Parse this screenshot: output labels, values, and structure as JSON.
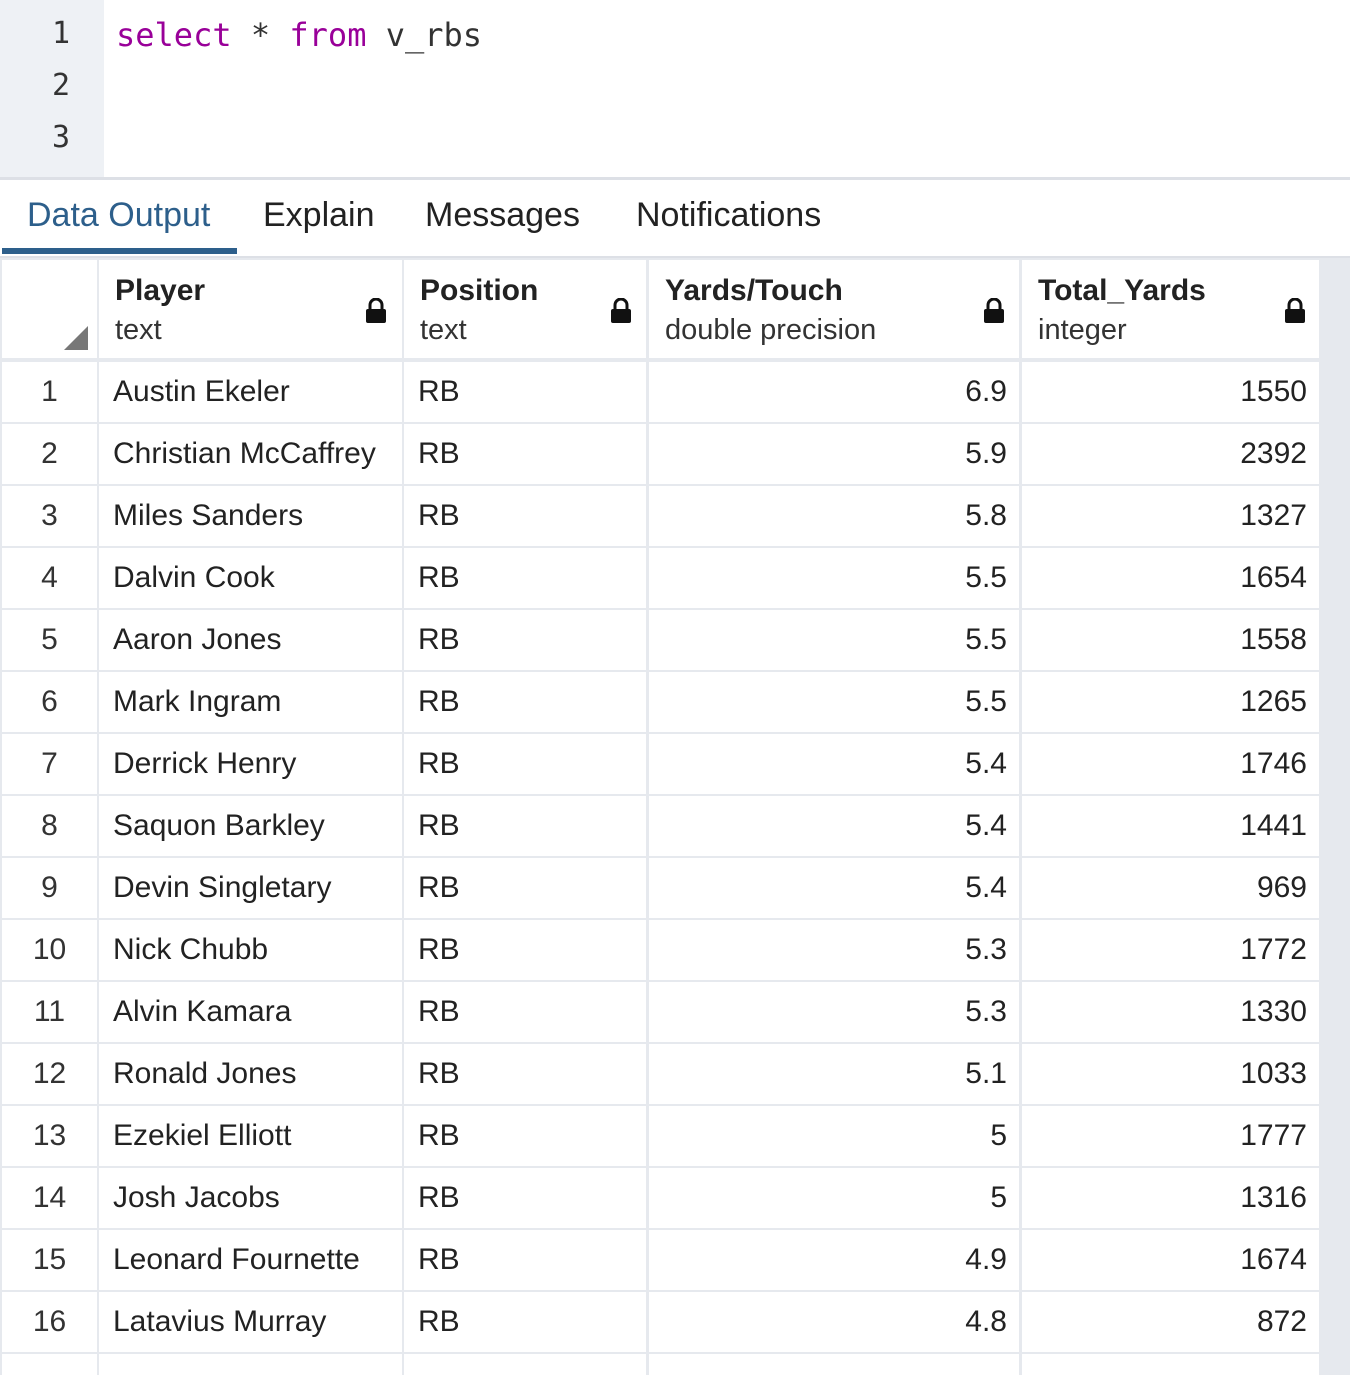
{
  "editor": {
    "line_numbers": [
      "1",
      "2",
      "3"
    ],
    "query": {
      "kw_select": "select",
      "star": "*",
      "kw_from": "from",
      "table": "v_rbs"
    }
  },
  "tabs": [
    {
      "label": "Data Output",
      "active": true
    },
    {
      "label": "Explain",
      "active": false
    },
    {
      "label": "Messages",
      "active": false
    },
    {
      "label": "Notifications",
      "active": false
    }
  ],
  "columns": [
    {
      "name": "Player",
      "type": "text",
      "locked": true
    },
    {
      "name": "Position",
      "type": "text",
      "locked": true
    },
    {
      "name": "Yards/Touch",
      "type": "double precision",
      "locked": true
    },
    {
      "name": "Total_Yards",
      "type": "integer",
      "locked": true
    }
  ],
  "rows": [
    {
      "n": "1",
      "player": "Austin Ekeler",
      "position": "RB",
      "ypt": "6.9",
      "yards": "1550"
    },
    {
      "n": "2",
      "player": "Christian McCaffrey",
      "position": "RB",
      "ypt": "5.9",
      "yards": "2392"
    },
    {
      "n": "3",
      "player": "Miles Sanders",
      "position": "RB",
      "ypt": "5.8",
      "yards": "1327"
    },
    {
      "n": "4",
      "player": "Dalvin Cook",
      "position": "RB",
      "ypt": "5.5",
      "yards": "1654"
    },
    {
      "n": "5",
      "player": "Aaron Jones",
      "position": "RB",
      "ypt": "5.5",
      "yards": "1558"
    },
    {
      "n": "6",
      "player": "Mark Ingram",
      "position": "RB",
      "ypt": "5.5",
      "yards": "1265"
    },
    {
      "n": "7",
      "player": "Derrick Henry",
      "position": "RB",
      "ypt": "5.4",
      "yards": "1746"
    },
    {
      "n": "8",
      "player": "Saquon Barkley",
      "position": "RB",
      "ypt": "5.4",
      "yards": "1441"
    },
    {
      "n": "9",
      "player": "Devin Singletary",
      "position": "RB",
      "ypt": "5.4",
      "yards": "969"
    },
    {
      "n": "10",
      "player": "Nick Chubb",
      "position": "RB",
      "ypt": "5.3",
      "yards": "1772"
    },
    {
      "n": "11",
      "player": "Alvin Kamara",
      "position": "RB",
      "ypt": "5.3",
      "yards": "1330"
    },
    {
      "n": "12",
      "player": "Ronald Jones",
      "position": "RB",
      "ypt": "5.1",
      "yards": "1033"
    },
    {
      "n": "13",
      "player": "Ezekiel Elliott",
      "position": "RB",
      "ypt": "5",
      "yards": "1777"
    },
    {
      "n": "14",
      "player": "Josh Jacobs",
      "position": "RB",
      "ypt": "5",
      "yards": "1316"
    },
    {
      "n": "15",
      "player": "Leonard Fournette",
      "position": "RB",
      "ypt": "4.9",
      "yards": "1674"
    },
    {
      "n": "16",
      "player": "Latavius Murray",
      "position": "RB",
      "ypt": "4.8",
      "yards": "872"
    }
  ],
  "colors": {
    "keyword": "#990099",
    "tab_active": "#2d5f8b",
    "gutter_bg": "#eef1f5",
    "grid_line": "#e6e9ee"
  },
  "icons": {
    "lock": "lock-icon",
    "corner": "select-all-corner-icon"
  }
}
